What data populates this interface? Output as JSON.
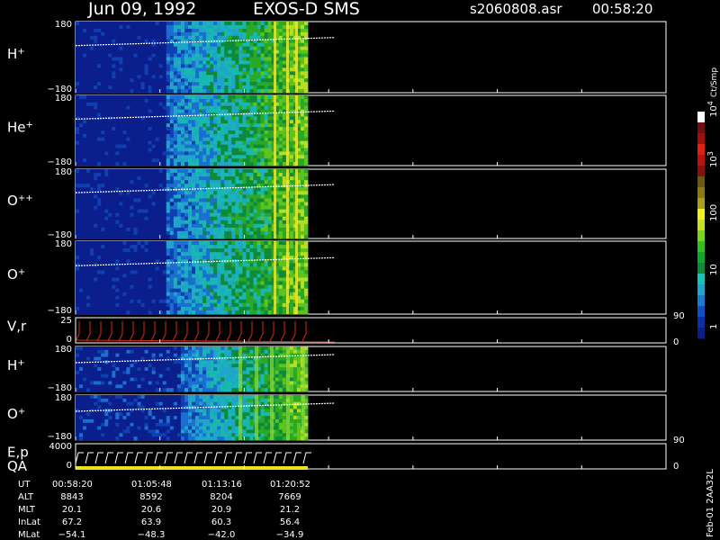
{
  "header": {
    "date": "Jun 09, 1992",
    "instrument": "EXOS-D SMS",
    "file": "s2060808.asr",
    "time": "00:58:20"
  },
  "colorbar": {
    "unit": "Ct/Smp",
    "ticks": [
      "1",
      "10",
      "100",
      "10",
      "10"
    ],
    "tick_exponents": [
      "",
      "",
      "",
      "3",
      "4"
    ],
    "colors": [
      "#0b1f8c",
      "#0a2fa6",
      "#0f4fc2",
      "#177cd2",
      "#1fa5c9",
      "#18c3b8",
      "#0f8a3a",
      "#0fa82f",
      "#2fc21e",
      "#7ad61a",
      "#c8e020",
      "#f0f01a",
      "#a8a020",
      "#8a7a10",
      "#6a5a10",
      "#8a1010",
      "#c01010",
      "#e02010",
      "#a01010",
      "#701010",
      "#ffffff"
    ]
  },
  "side_scale": {
    "vr_top": "90",
    "vr_bottom": "0",
    "ep_top": "90",
    "ep_bottom": "0"
  },
  "chart_data": {
    "type": "heatmap",
    "panels": [
      {
        "name": "H",
        "superscript": "+",
        "ymax": "180",
        "ymin": "−180"
      },
      {
        "name": "He",
        "superscript": "+",
        "ymax": "180",
        "ymin": "−180"
      },
      {
        "name": "O",
        "superscript": "++",
        "ymax": "180",
        "ymin": "−180"
      },
      {
        "name": "O",
        "superscript": "+",
        "ymax": "180",
        "ymin": "−180"
      },
      {
        "name": "V,r",
        "superscript": "",
        "ymax": "25",
        "ymin": "0"
      },
      {
        "name": "H",
        "superscript": "+",
        "ymax": "180",
        "ymin": "−180"
      },
      {
        "name": "O",
        "superscript": "+",
        "ymax": "180",
        "ymin": "−180"
      },
      {
        "name": "E,p",
        "superscript": "",
        "ymax": "4000",
        "ymin": "0"
      }
    ],
    "qa_label": "QA",
    "ephemeris": {
      "labels": [
        "UT",
        "ALT",
        "MLT",
        "InLat",
        "MLat"
      ],
      "columns": [
        [
          "00:58:20",
          "8843",
          "20.1",
          "67.2",
          "−54.1"
        ],
        [
          "01:05:48",
          "8592",
          "20.6",
          "63.9",
          "−48.3"
        ],
        [
          "01:13:16",
          "8204",
          "20.9",
          "60.3",
          "−42.0"
        ],
        [
          "01:20:52",
          "7669",
          "21.2",
          "56.4",
          "−34.9"
        ]
      ]
    },
    "footer": "Feb-01 2AA32L"
  }
}
